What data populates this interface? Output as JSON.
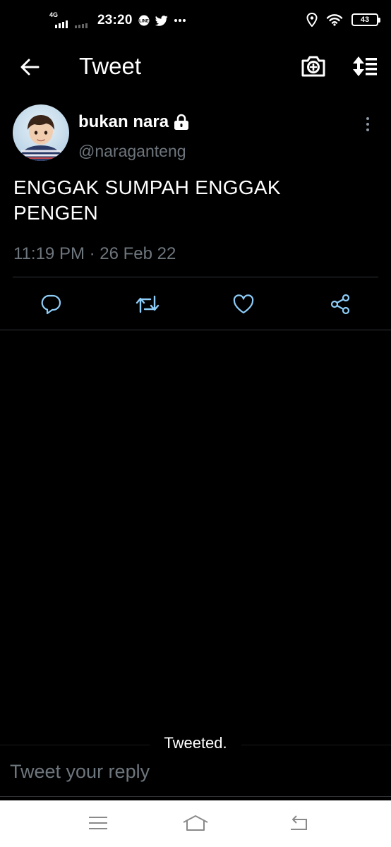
{
  "status_bar": {
    "network": "4G",
    "time": "23:20",
    "battery": "43",
    "icons": [
      "signal-icon",
      "line-app-icon",
      "twitter-icon",
      "more-notifications-icon",
      "location-icon",
      "wifi-icon",
      "battery-icon"
    ]
  },
  "header": {
    "title": "Tweet",
    "icons": [
      "back-arrow-icon",
      "camera-plus-icon",
      "sort-icon"
    ]
  },
  "tweet": {
    "display_name": "bukan nara",
    "handle": "@naraganteng",
    "protected": true,
    "text": "ENGGAK SUMPAH ENGGAK PENGEN",
    "timestamp": "11:19 PM · 26 Feb 22",
    "actions": [
      "reply-icon",
      "retweet-icon",
      "like-icon",
      "share-icon"
    ]
  },
  "toast": {
    "message": "Tweeted."
  },
  "reply": {
    "placeholder": "Tweet your reply"
  },
  "nav": {
    "icons": [
      "menu-icon",
      "home-icon",
      "back-icon"
    ]
  },
  "colors": {
    "background": "#000000",
    "text": "#ffffff",
    "secondary_text": "#6e767d",
    "icon_accent": "#8ecdf8",
    "divider": "#2f3336",
    "navbar": "#ffffff"
  }
}
